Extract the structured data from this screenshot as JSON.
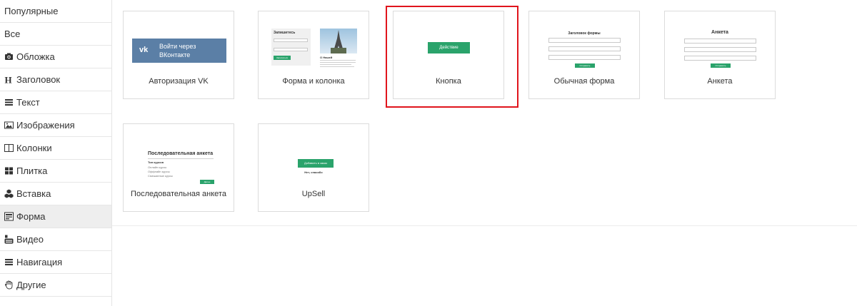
{
  "sidebar": {
    "items": [
      {
        "label": "Популярные",
        "icon": "none",
        "active": false
      },
      {
        "label": "Все",
        "icon": "none",
        "active": false
      },
      {
        "label": "Обложка",
        "icon": "camera-icon",
        "active": false
      },
      {
        "label": "Заголовок",
        "icon": "heading-icon",
        "active": false
      },
      {
        "label": "Текст",
        "icon": "text-lines-icon",
        "active": false
      },
      {
        "label": "Изображения",
        "icon": "image-icon",
        "active": false
      },
      {
        "label": "Колонки",
        "icon": "columns-icon",
        "active": false
      },
      {
        "label": "Плитка",
        "icon": "tiles-icon",
        "active": false
      },
      {
        "label": "Вставка",
        "icon": "cubes-icon",
        "active": false
      },
      {
        "label": "Форма",
        "icon": "form-icon",
        "active": true
      },
      {
        "label": "Видео",
        "icon": "youtube-icon",
        "active": false
      },
      {
        "label": "Навигация",
        "icon": "menu-icon",
        "active": false
      },
      {
        "label": "Другие",
        "icon": "hand-icon",
        "active": false
      }
    ]
  },
  "cards": [
    {
      "label": "Авторизация VK",
      "preview": {
        "line1": "Войти через",
        "line2": "ВКонтакте"
      }
    },
    {
      "label": "Форма и колонка",
      "preview": {
        "title": "Запишитесь",
        "button": "Записаться",
        "caption": "О Нашей"
      }
    },
    {
      "label": "Кнопка",
      "preview": {
        "button": "Действие"
      },
      "selected": true
    },
    {
      "label": "Обычная форма",
      "preview": {
        "title": "Заголовок формы",
        "button": "Отправить"
      }
    },
    {
      "label": "Анкета",
      "preview": {
        "title": "Анкета",
        "button": "Отправить"
      }
    },
    {
      "label": "Последовательная анкета",
      "preview": {
        "title": "Последовательная анкета",
        "question": "Тип курсов",
        "options": [
          "Онлайн курсы",
          "Оффлайн курсы",
          "Смешанные курсы"
        ],
        "button": "Далее"
      }
    },
    {
      "label": "UpSell",
      "preview": {
        "button": "Добавить в заказ",
        "link": "Нет, спасибо"
      }
    }
  ],
  "colors": {
    "accent_green": "#2aa36b",
    "vk_blue": "#5b7fa6",
    "selection_red": "#e0141c"
  }
}
